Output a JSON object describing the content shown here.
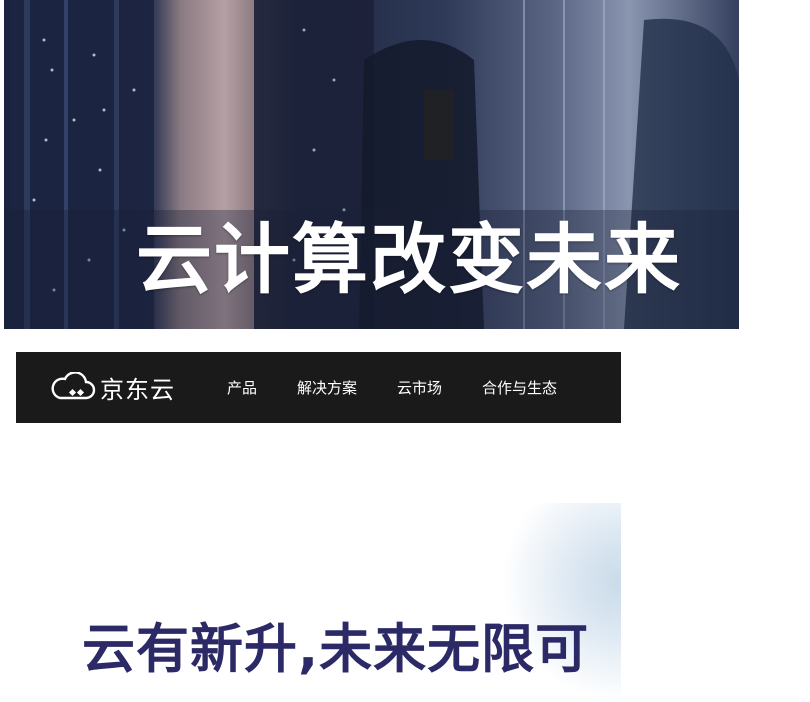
{
  "hero": {
    "title": "云计算改变未来"
  },
  "navbar": {
    "logo_text": "京东云",
    "items": [
      {
        "label": "产品"
      },
      {
        "label": "解决方案"
      },
      {
        "label": "云市场"
      },
      {
        "label": "合作与生态"
      }
    ],
    "background": "#1a1a1a"
  },
  "banner": {
    "title": "云有新升,未来无限可",
    "title_color": "#2c2a66"
  },
  "icons": {
    "logo": "cloud-logo-icon"
  }
}
